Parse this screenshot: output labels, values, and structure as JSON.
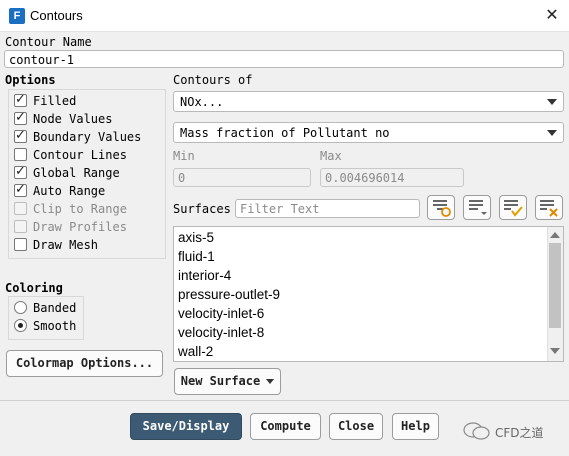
{
  "window": {
    "title": "Contours",
    "app_icon_letter": "F"
  },
  "contour_name": {
    "label": "Contour Name",
    "value": "contour-1"
  },
  "options": {
    "label": "Options",
    "items": [
      {
        "label": "Filled",
        "checked": true,
        "enabled": true
      },
      {
        "label": "Node Values",
        "checked": true,
        "enabled": true
      },
      {
        "label": "Boundary Values",
        "checked": true,
        "enabled": true
      },
      {
        "label": "Contour Lines",
        "checked": false,
        "enabled": true
      },
      {
        "label": "Global Range",
        "checked": true,
        "enabled": true
      },
      {
        "label": "Auto Range",
        "checked": true,
        "enabled": true
      },
      {
        "label": "Clip to Range",
        "checked": false,
        "enabled": false
      },
      {
        "label": "Draw Profiles",
        "checked": false,
        "enabled": false
      },
      {
        "label": "Draw Mesh",
        "checked": false,
        "enabled": true
      }
    ]
  },
  "coloring": {
    "label": "Coloring",
    "options": [
      {
        "label": "Banded",
        "selected": false
      },
      {
        "label": "Smooth",
        "selected": true
      }
    ]
  },
  "colormap_button": "Colormap Options...",
  "contours_of": {
    "label": "Contours of",
    "primary": "NOx...",
    "secondary": "Mass fraction of Pollutant no"
  },
  "range": {
    "min_label": "Min",
    "min_value": "0",
    "max_label": "Max",
    "max_value": "0.004696014"
  },
  "surfaces": {
    "label": "Surfaces",
    "filter_placeholder": "Filter Text",
    "items": [
      "axis-5",
      "fluid-1",
      "interior-4",
      "pressure-outlet-9",
      "velocity-inlet-6",
      "velocity-inlet-8",
      "wall-2"
    ],
    "scroll_fraction": 0.85
  },
  "new_surface_button": "New Surface",
  "footer": {
    "save_display": "Save/Display",
    "compute": "Compute",
    "close": "Close",
    "help": "Help"
  },
  "watermark": "CFD之道",
  "icons": {
    "close": "close-icon",
    "select_all": "select-all-icon",
    "deselect": "deselect-all-icon",
    "filter": "filter-icon",
    "highlight": "highlight-icon"
  }
}
